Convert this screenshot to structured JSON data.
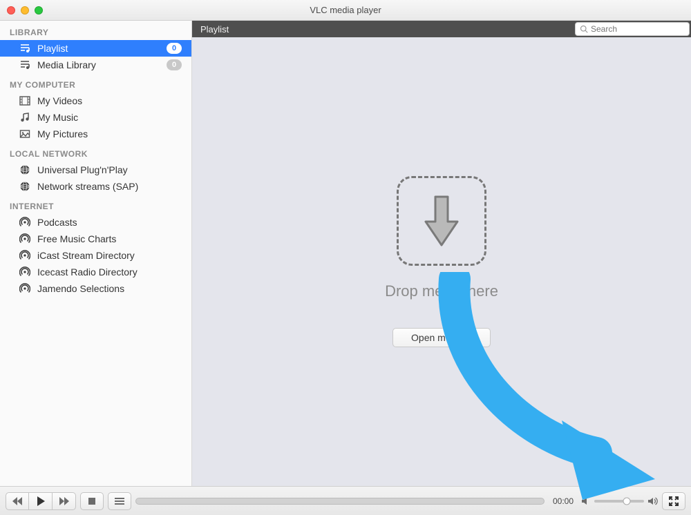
{
  "window_title": "VLC media player",
  "sidebar": {
    "sections": [
      {
        "header": "LIBRARY",
        "items": [
          {
            "icon": "playlist",
            "label": "Playlist",
            "badge": "0",
            "selected": true
          },
          {
            "icon": "library",
            "label": "Media Library",
            "badge": "0"
          }
        ]
      },
      {
        "header": "MY COMPUTER",
        "items": [
          {
            "icon": "video",
            "label": "My Videos"
          },
          {
            "icon": "music",
            "label": "My Music"
          },
          {
            "icon": "pictures",
            "label": "My Pictures"
          }
        ]
      },
      {
        "header": "LOCAL NETWORK",
        "items": [
          {
            "icon": "globe",
            "label": "Universal Plug'n'Play"
          },
          {
            "icon": "globe",
            "label": "Network streams (SAP)"
          }
        ]
      },
      {
        "header": "INTERNET",
        "items": [
          {
            "icon": "podcast",
            "label": "Podcasts"
          },
          {
            "icon": "podcast",
            "label": "Free Music Charts"
          },
          {
            "icon": "podcast",
            "label": "iCast Stream Directory"
          },
          {
            "icon": "podcast",
            "label": "Icecast Radio Directory"
          },
          {
            "icon": "podcast",
            "label": "Jamendo Selections"
          }
        ]
      }
    ]
  },
  "header": {
    "title": "Playlist",
    "search_placeholder": "Search"
  },
  "dropzone": {
    "label": "Drop media here",
    "open_button": "Open media..."
  },
  "controls": {
    "time": "00:00",
    "volume_percent": 65
  },
  "colors": {
    "selection": "#2f7ffd",
    "annotation_arrow": "#35aef1"
  }
}
